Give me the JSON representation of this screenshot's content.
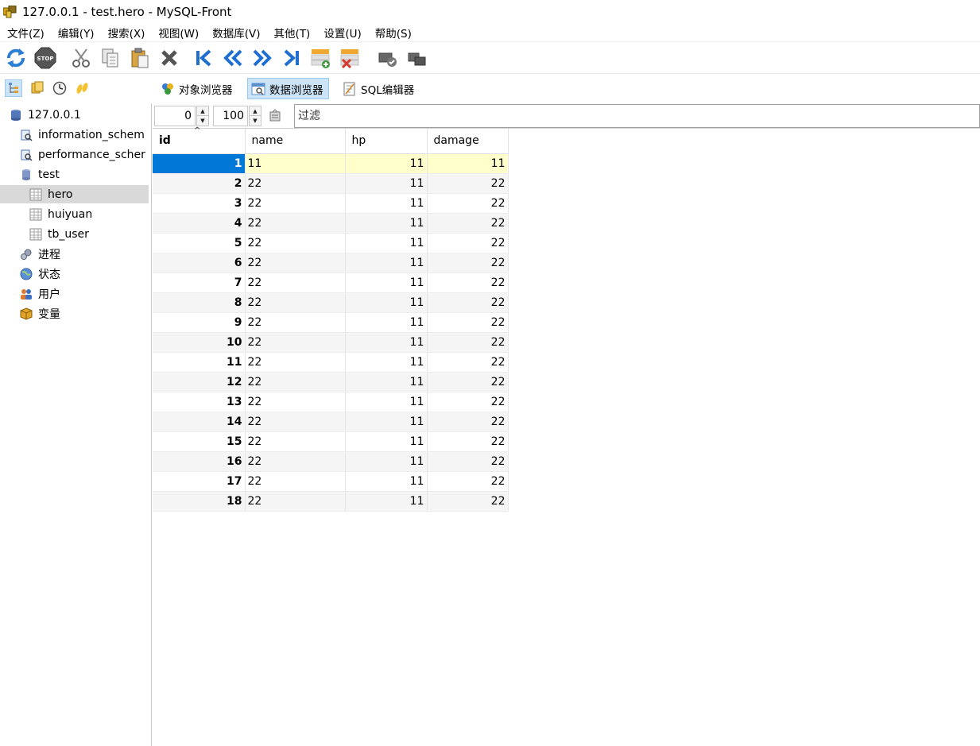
{
  "window": {
    "title": "127.0.0.1 - test.hero - MySQL-Front"
  },
  "menu": [
    "文件(Z)",
    "编辑(Y)",
    "搜索(X)",
    "视图(W)",
    "数据库(V)",
    "其他(T)",
    "设置(U)",
    "帮助(S)"
  ],
  "toolbar": {
    "icons": [
      "refresh-icon",
      "stop-icon",
      "cut-icon",
      "copy-icon",
      "paste-icon",
      "delete-icon",
      "first-record-icon",
      "previous-icon",
      "next-icon",
      "last-record-icon",
      "insert-record-icon",
      "delete-record-icon",
      "commit-icon",
      "rollback-icon"
    ]
  },
  "views": {
    "object_browser": "对象浏览器",
    "data_browser": "数据浏览器",
    "sql_editor": "SQL编辑器"
  },
  "tree": {
    "host": "127.0.0.1",
    "databases": [
      "information_schem",
      "performance_scher",
      "test"
    ],
    "tables": [
      "hero",
      "huiyuan",
      "tb_user"
    ],
    "selected_table": "hero",
    "extras": [
      "进程",
      "状态",
      "用户",
      "变量"
    ]
  },
  "navigator": {
    "offset": "0",
    "limit": "100",
    "filter_placeholder": "过滤"
  },
  "grid": {
    "columns": [
      "id",
      "name",
      "hp",
      "damage"
    ],
    "rows": [
      [
        "1",
        "11",
        "11",
        "11"
      ],
      [
        "2",
        "22",
        "11",
        "22"
      ],
      [
        "3",
        "22",
        "11",
        "22"
      ],
      [
        "4",
        "22",
        "11",
        "22"
      ],
      [
        "5",
        "22",
        "11",
        "22"
      ],
      [
        "6",
        "22",
        "11",
        "22"
      ],
      [
        "7",
        "22",
        "11",
        "22"
      ],
      [
        "8",
        "22",
        "11",
        "22"
      ],
      [
        "9",
        "22",
        "11",
        "22"
      ],
      [
        "10",
        "22",
        "11",
        "22"
      ],
      [
        "11",
        "22",
        "11",
        "22"
      ],
      [
        "12",
        "22",
        "11",
        "22"
      ],
      [
        "13",
        "22",
        "11",
        "22"
      ],
      [
        "14",
        "22",
        "11",
        "22"
      ],
      [
        "15",
        "22",
        "11",
        "22"
      ],
      [
        "16",
        "22",
        "11",
        "22"
      ],
      [
        "17",
        "22",
        "11",
        "22"
      ],
      [
        "18",
        "22",
        "11",
        "22"
      ]
    ]
  },
  "colors": {
    "selected_cell": "#0078d7",
    "current_row": "#ffffcc",
    "alt_row": "#f5f5f5",
    "active_tab": "#cce4f7"
  }
}
